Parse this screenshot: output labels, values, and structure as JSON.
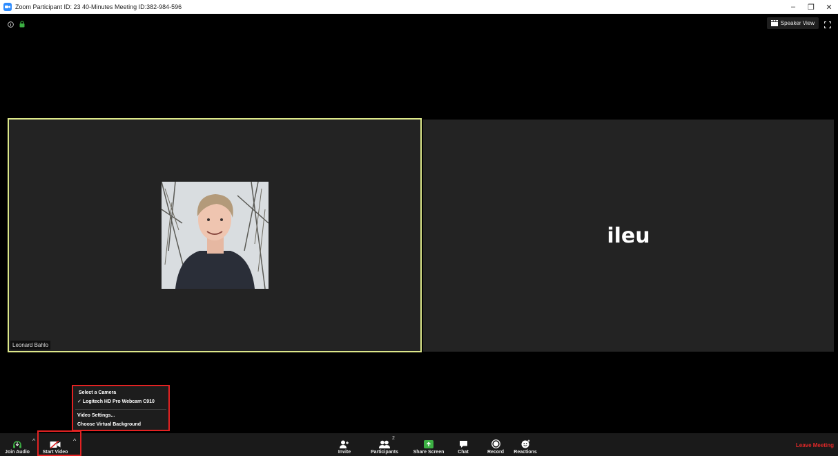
{
  "window": {
    "title": "Zoom Participant ID: 23   40-Minutes Meeting ID:382-984-596",
    "minimize": "–",
    "restore": "❐",
    "close": "✕"
  },
  "view": {
    "speaker_view_label": "Speaker View"
  },
  "tiles": {
    "left_name": "Leonard Bahlo",
    "right_name": "ileu"
  },
  "camera_menu": {
    "heading": "Select a Camera",
    "selected_camera": "✓ Logitech HD Pro Webcam C910",
    "video_settings": "Video Settings...",
    "virtual_background": "Choose Virtual Background"
  },
  "toolbar": {
    "join_audio": "Join Audio",
    "start_video": "Start Video",
    "invite": "Invite",
    "participants": "Participants",
    "participants_count": "2",
    "share_screen": "Share Screen",
    "chat": "Chat",
    "record": "Record",
    "reactions": "Reactions",
    "leave_meeting": "Leave Meeting"
  },
  "colors": {
    "accent_green": "#3cb043",
    "active_border": "#dde88a",
    "highlight_red": "#e32222",
    "leave_red": "#e02828"
  }
}
